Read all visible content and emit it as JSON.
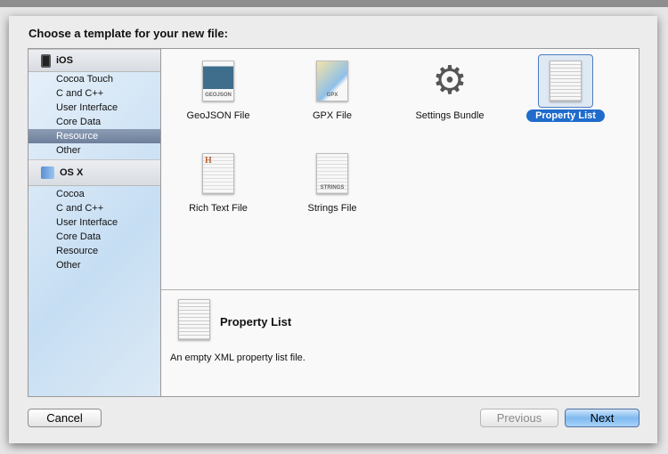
{
  "dialog": {
    "title": "Choose a template for your new file:"
  },
  "sidebar": {
    "groups": [
      {
        "label": "iOS",
        "icon": "iphone-icon",
        "items": [
          "Cocoa Touch",
          "C and C++",
          "User Interface",
          "Core Data",
          "Resource",
          "Other"
        ],
        "selected": "Resource"
      },
      {
        "label": "OS X",
        "icon": "finder-icon",
        "items": [
          "Cocoa",
          "C and C++",
          "User Interface",
          "Core Data",
          "Resource",
          "Other"
        ]
      }
    ]
  },
  "templates": [
    {
      "label": "GeoJSON File",
      "tag": "GEOJSON"
    },
    {
      "label": "GPX File",
      "tag": "GPX"
    },
    {
      "label": "Settings Bundle",
      "tag": ""
    },
    {
      "label": "Property List",
      "tag": "",
      "selected": true
    },
    {
      "label": "Rich Text File",
      "tag": "H"
    },
    {
      "label": "Strings File",
      "tag": "STRINGS"
    }
  ],
  "detail": {
    "title": "Property List",
    "description": "An empty XML property list file."
  },
  "buttons": {
    "cancel": "Cancel",
    "previous": "Previous",
    "next": "Next"
  },
  "colors": {
    "selection": "#1f6ccc",
    "sidebar_selection": "#7486a2"
  }
}
